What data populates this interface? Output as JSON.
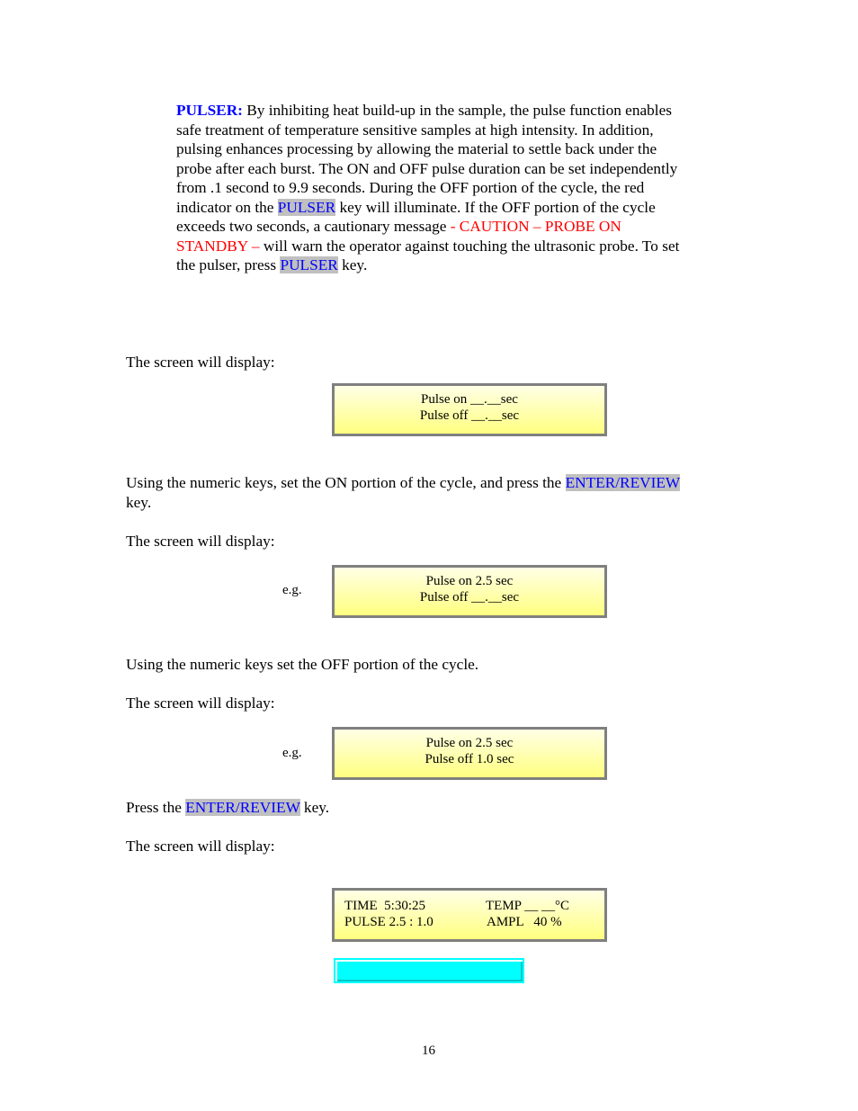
{
  "pulser_section": {
    "heading": "PULSER:",
    "text_1": " By inhibiting heat build-up in the sample, the pulse function enables",
    "line_2": "safe treatment of temperature sensitive samples at high intensity. In addition,",
    "line_3": "pulsing enhances processing by allowing the material to settle back under the",
    "line_4": "probe after each burst. The ON and OFF pulse duration can be set independently",
    "line_5": "from .1 second to 9.9 seconds. During the OFF portion of the cycle, the red",
    "line_6_a": "indicator on the ",
    "pulser_key_1": "PULSER",
    "line_6_b": " key will illuminate. If the OFF portion of the cycle",
    "line_7_a": "exceeds two seconds, a cautionary message ",
    "caution_1": " - CAUTION – PROBE ON",
    "caution_2": "STANDBY –",
    "line_8_b": " will warn the operator against touching the ultrasonic probe. To set",
    "line_9_a": "the pulser, press ",
    "pulser_key_2": "PULSER",
    "line_9_b": " key."
  },
  "steps": {
    "screen_display_1": "The screen will display:",
    "lcd_1": {
      "line_1": "Pulse on __.__sec",
      "line_2": "Pulse off __.__sec"
    },
    "set_on_a": "Using the numeric keys, set the ON portion of the cycle, and press the ",
    "enter_review_key_1": "ENTER/REVIEW",
    "set_on_b": "key.",
    "screen_display_2": "The screen will display:",
    "eg_1": "e.g.",
    "lcd_2": {
      "line_1": "Pulse on 2.5 sec",
      "line_2": "Pulse off __.__sec"
    },
    "set_off": "Using the numeric keys set the OFF portion of the cycle.",
    "screen_display_3": "The screen will display:",
    "eg_2": "e.g.",
    "lcd_3": {
      "line_1": "Pulse on 2.5 sec",
      "line_2": "Pulse off 1.0 sec"
    },
    "press_a": "Press the ",
    "enter_review_key_2": "ENTER/REVIEW",
    "press_b": " key.",
    "screen_display_4": "The screen will display:",
    "lcd_4": {
      "time_label": "TIME  5:30:25",
      "temp_label": "TEMP __ __°C",
      "pulse_label": "PULSE 2.5 : 1.0",
      "ampl_label": "AMPL   40 %"
    }
  },
  "footer": {
    "page_number": "16"
  }
}
